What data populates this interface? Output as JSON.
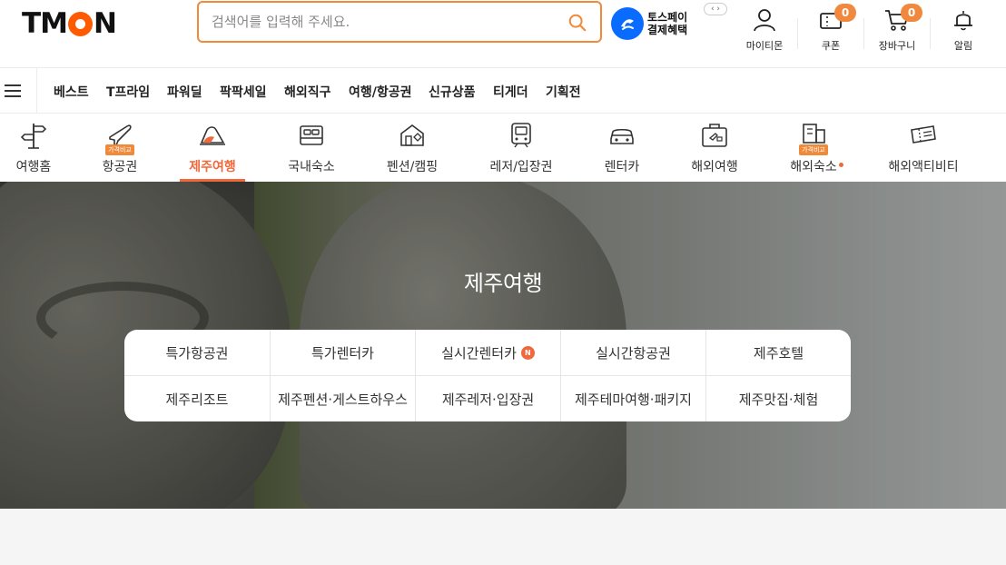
{
  "header": {
    "logo": "TMON",
    "search_placeholder": "검색어를 입력해 주세요.",
    "toss_line1": "토스페이",
    "toss_line2": "결제혜택",
    "toss_nav": "‹ ›",
    "icons": [
      {
        "label": "마이티몬",
        "icon": "user-icon"
      },
      {
        "label": "쿠폰",
        "icon": "coupon-icon",
        "badge": "0"
      },
      {
        "label": "장바구니",
        "icon": "cart-icon",
        "badge": "0"
      },
      {
        "label": "알림",
        "icon": "bell-icon"
      }
    ]
  },
  "nav": {
    "items": [
      "베스트",
      "T프라임",
      "파워딜",
      "팍팍세일",
      "해외직구",
      "여행/항공권",
      "신규상품",
      "티게더",
      "기획전"
    ]
  },
  "categories": [
    {
      "label": "여행홈"
    },
    {
      "label": "항공권",
      "pill": "가격비교"
    },
    {
      "label": "제주여행",
      "active": true
    },
    {
      "label": "국내숙소"
    },
    {
      "label": "펜션/캠핑"
    },
    {
      "label": "레저/입장권"
    },
    {
      "label": "렌터카"
    },
    {
      "label": "해외여행"
    },
    {
      "label": "해외숙소",
      "pill": "가격비교"
    },
    {
      "label": "해외액티비티"
    }
  ],
  "hero": {
    "title": "제주여행",
    "links_row1": [
      "특가항공권",
      "특가렌터카",
      "실시간렌터카",
      "실시간항공권",
      "제주호텔"
    ],
    "links_row2": [
      "제주리조트",
      "제주펜션·게스트하우스",
      "제주레저·입장권",
      "제주테마여행·패키지",
      "제주맛집·체험"
    ],
    "new_badge": "N"
  },
  "colors": {
    "accent": "#f0683c",
    "search_border": "#f28a3b",
    "toss_blue": "#0a6cff"
  }
}
